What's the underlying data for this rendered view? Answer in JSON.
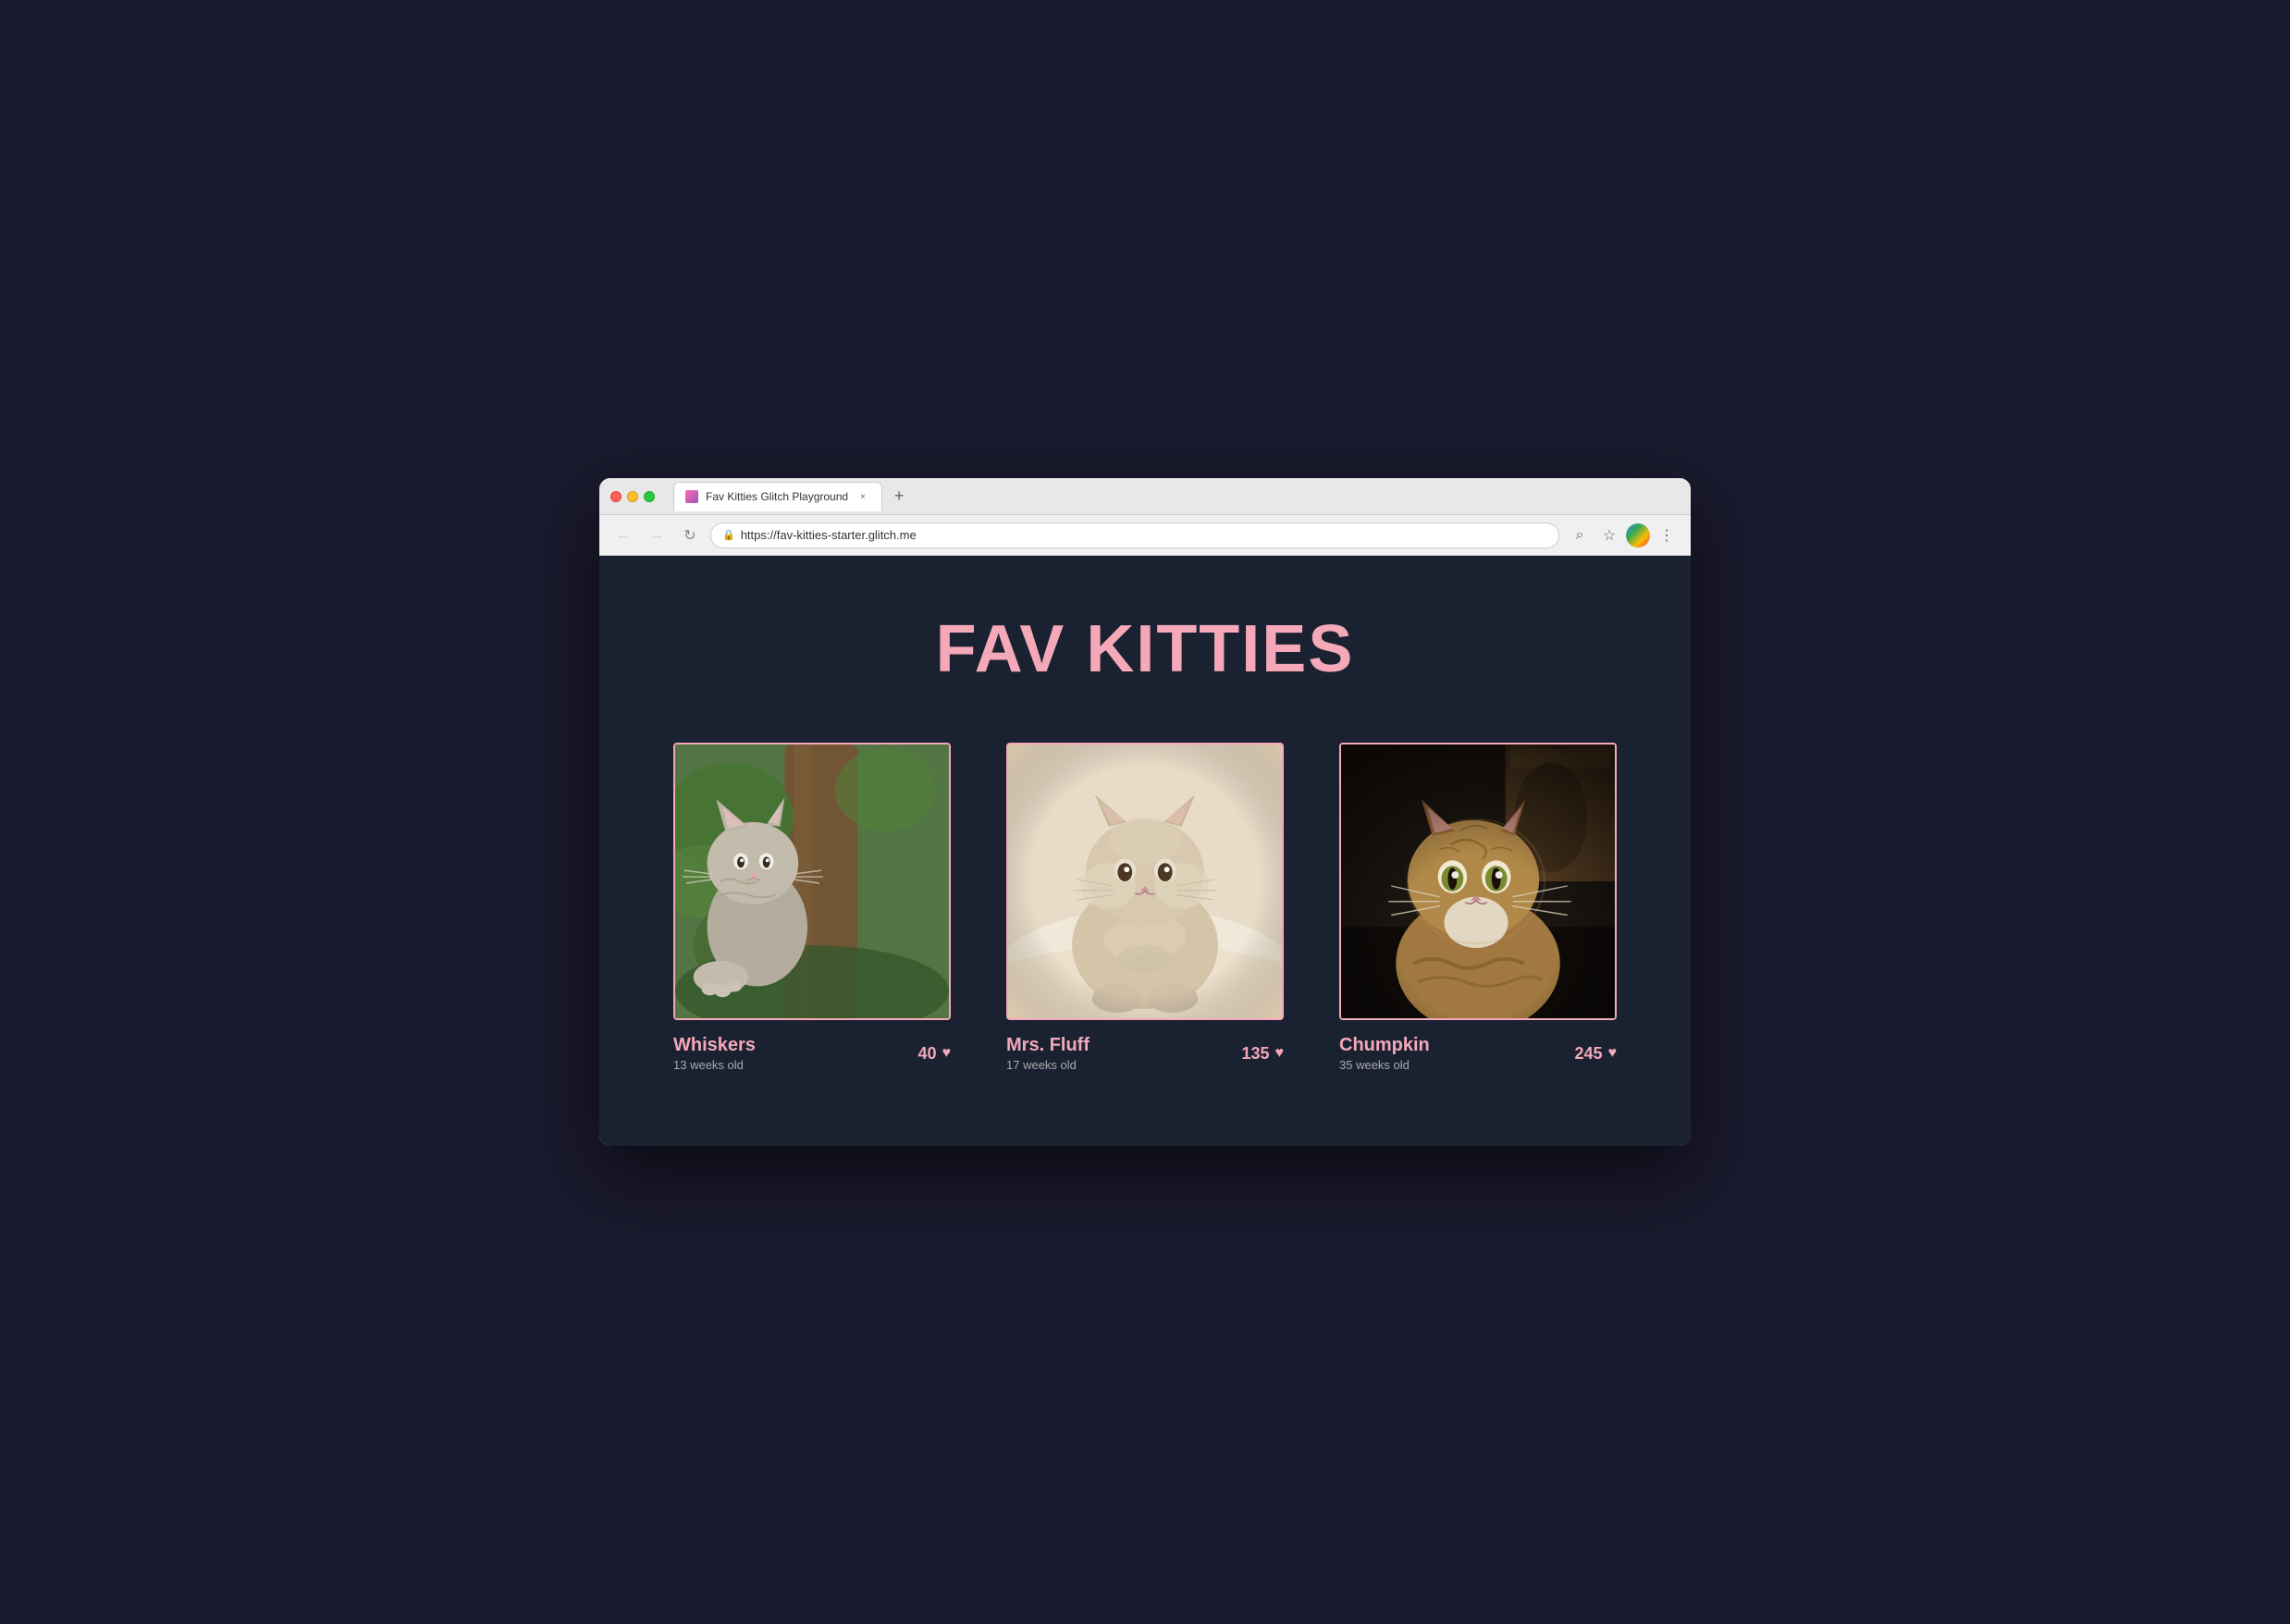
{
  "browser": {
    "tab_title": "Fav Kitties Glitch Playground",
    "tab_favicon_alt": "glitch favicon",
    "close_label": "×",
    "new_tab_label": "+",
    "back_label": "←",
    "forward_label": "→",
    "refresh_label": "↻",
    "url": "https://fav-kitties-starter.glitch.me",
    "lock_icon": "🔒",
    "search_icon": "⌕",
    "star_icon": "☆",
    "menu_icon": "⋮"
  },
  "page": {
    "heading": "FAV KITTIES",
    "cats": [
      {
        "id": "whiskers",
        "name": "Whiskers",
        "age": "13 weeks old",
        "votes": "40",
        "heart": "♥",
        "img_style": "cat1"
      },
      {
        "id": "mrs-fluff",
        "name": "Mrs. Fluff",
        "age": "17 weeks old",
        "votes": "135",
        "heart": "♥",
        "img_style": "cat2"
      },
      {
        "id": "chumpkin",
        "name": "Chumpkin",
        "age": "35 weeks old",
        "votes": "245",
        "heart": "♥",
        "img_style": "cat3"
      }
    ]
  }
}
